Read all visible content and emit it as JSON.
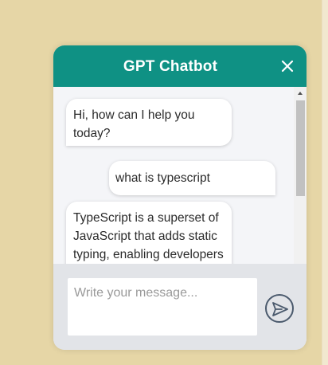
{
  "header": {
    "title": "GPT Chatbot",
    "close_icon": "close-icon",
    "background_color": "#0f9184"
  },
  "messages": [
    {
      "role": "bot",
      "text": "Hi, how can I help you today?"
    },
    {
      "role": "user",
      "text": "what is typescript"
    },
    {
      "role": "bot",
      "text": "TypeScript is a superset of JavaScript that adds static typing, enabling developers"
    }
  ],
  "composer": {
    "placeholder": "Write your message...",
    "value": "",
    "send_icon": "send-icon"
  },
  "colors": {
    "page_background": "#e6d6a6",
    "bubble_background": "#ffffff",
    "messages_background": "#f4f5f8",
    "input_area_background": "#e2e4e8"
  }
}
